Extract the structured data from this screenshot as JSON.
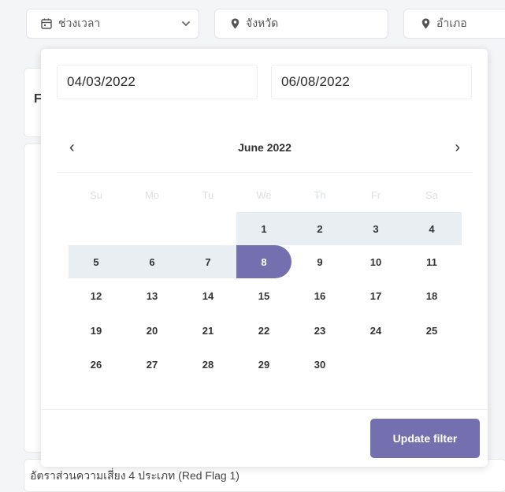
{
  "filters": {
    "date_label": "ช่วงเวลา",
    "province_label": "จังหวัด",
    "district_label": "อำเภอ"
  },
  "background": {
    "card_peek_char": "F",
    "bottom_text": "อัตราส่วนความเสี่ยง 4 ประเภท (Red Flag 1)"
  },
  "datepicker": {
    "start_date": "04/03/2022",
    "end_date": "06/08/2022",
    "month_title": "June 2022",
    "prev_symbol": "‹",
    "next_symbol": "›",
    "weekdays": [
      "Su",
      "Mo",
      "Tu",
      "We",
      "Th",
      "Fr",
      "Sa"
    ],
    "days": [
      "1",
      "2",
      "3",
      "4",
      "5",
      "6",
      "7",
      "8",
      "9",
      "10",
      "11",
      "12",
      "13",
      "14",
      "15",
      "16",
      "17",
      "18",
      "19",
      "20",
      "21",
      "22",
      "23",
      "24",
      "25",
      "26",
      "27",
      "28",
      "29",
      "30"
    ],
    "selected_day": "8",
    "update_button": "Update filter"
  },
  "colors": {
    "accent": "#7470b0",
    "range_highlight": "#e9eef2"
  }
}
